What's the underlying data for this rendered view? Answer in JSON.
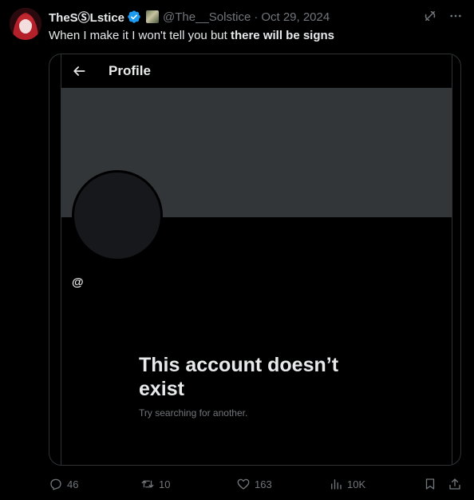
{
  "author": {
    "display_name": "TheSⓈLstice",
    "handle": "@The__Solstice",
    "separator": "·",
    "date": "Oct 29, 2024"
  },
  "tweet": {
    "text_plain": "When I make it I won't tell you but ",
    "text_bold": "there will be signs"
  },
  "embedded_screenshot": {
    "header_title": "Profile",
    "at_symbol": "@",
    "empty_title": "This account doesn’t exist",
    "empty_subtitle": "Try searching for another."
  },
  "actions": {
    "reply_count": "46",
    "retweet_count": "10",
    "like_count": "163",
    "views_count": "10K"
  },
  "icons": {
    "verified": "verified-badge-icon",
    "grok": "grok-icon",
    "more": "more-icon",
    "back": "back-arrow-icon",
    "reply": "reply-icon",
    "retweet": "retweet-icon",
    "like": "heart-icon",
    "views": "views-icon",
    "bookmark": "bookmark-icon",
    "share": "share-icon"
  },
  "colors": {
    "background": "#000000",
    "text_primary": "#e7e9ea",
    "text_secondary": "#71767b",
    "verified_blue": "#1d9bf0",
    "banner": "#333639"
  }
}
